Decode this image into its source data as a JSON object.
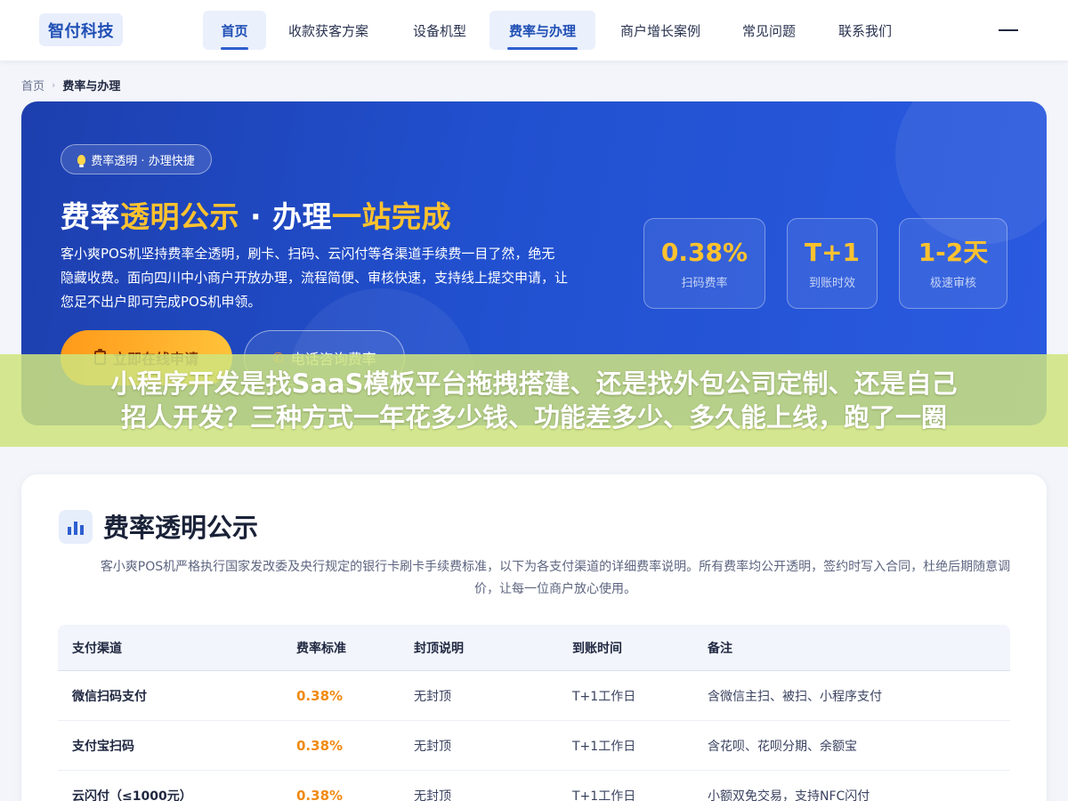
{
  "header": {
    "logo": "智付科技",
    "nav": [
      {
        "label": "首页",
        "active": true
      },
      {
        "label": "收款获客方案",
        "active": false
      },
      {
        "label": "设备机型",
        "active": false
      },
      {
        "label": "费率与办理",
        "active": true
      },
      {
        "label": "商户增长案例",
        "active": false
      },
      {
        "label": "常见问题",
        "active": false
      },
      {
        "label": "联系我们",
        "active": false
      }
    ]
  },
  "breadcrumb": {
    "home": "首页",
    "separator": "›",
    "current": "费率与办理"
  },
  "hero": {
    "badge": "费率透明 · 办理快捷",
    "title": {
      "part1": "费率",
      "part2": "透明公示",
      "part3": " · 办理",
      "part4": "一站完成"
    },
    "description": "客小爽POS机坚持费率全透明，刷卡、扫码、云闪付等各渠道手续费一目了然，绝无隐藏收费。面向四川中小商户开放办理，流程简便、审核快速，支持线上提交申请，让您足不出户即可完成POS机申领。",
    "primary_button": "立即在线申请",
    "secondary_button": "电话咨询费率",
    "stats": [
      {
        "value": "0.38%",
        "label": "扫码费率"
      },
      {
        "value": "T+1",
        "label": "到账时效"
      },
      {
        "value": "1-2天",
        "label": "极速审核"
      }
    ],
    "accent_color": "#ffc22e"
  },
  "overlay": {
    "line1": "小程序开发是找SaaS模板平台拖拽搭建、还是找外包公司定制、还是自己",
    "line2": "招人开发？三种方式一年花多少钱、功能差多少、多久能上线，跑了一圈"
  },
  "section": {
    "title": "费率透明公示",
    "description": "客小爽POS机严格执行国家发改委及央行规定的银行卡刷卡手续费标准，以下为各支付渠道的详细费率说明。所有费率均公开透明，签约时写入合同，杜绝后期随意调价，让每一位商户放心使用。",
    "table": {
      "headers": [
        "支付渠道",
        "费率标准",
        "封顶说明",
        "到账时间",
        "备注"
      ],
      "rows": [
        {
          "channel": "微信扫码支付",
          "rate": "0.38%",
          "cap": "无封顶",
          "settle": "T+1工作日",
          "note": "含微信主扫、被扫、小程序支付"
        },
        {
          "channel": "支付宝扫码",
          "rate": "0.38%",
          "cap": "无封顶",
          "settle": "T+1工作日",
          "note": "含花呗、花呗分期、余额宝"
        },
        {
          "channel": "云闪付（≤1000元）",
          "rate": "0.38%",
          "cap": "无封顶",
          "settle": "T+1工作日",
          "note": "小额双免交易，支持NFC闪付"
        }
      ]
    }
  }
}
